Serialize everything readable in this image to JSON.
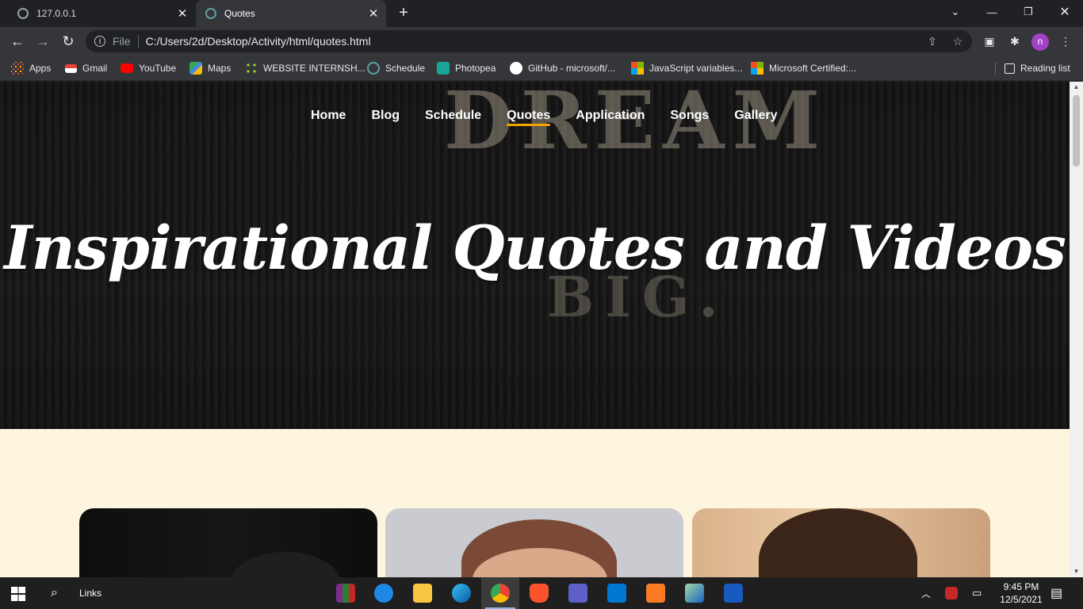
{
  "browser": {
    "tabs": [
      {
        "title": "127.0.0.1",
        "active": false
      },
      {
        "title": "Quotes",
        "active": true
      }
    ],
    "address": {
      "scheme_label": "File",
      "url": "C:/Users/2d/Desktop/Activity/html/quotes.html"
    },
    "profile_initial": "n",
    "bookmarks": [
      {
        "label": "Apps",
        "icon": "apps-grid-icon",
        "color": "#ea4335"
      },
      {
        "label": "Gmail",
        "icon": "gmail-icon",
        "color": "#ea4335"
      },
      {
        "label": "YouTube",
        "icon": "youtube-icon",
        "color": "#ff0000"
      },
      {
        "label": "Maps",
        "icon": "maps-icon",
        "color": "#34a853"
      },
      {
        "label": "WEBSITE INTERNSH...",
        "icon": "bookmark-icon",
        "color": "#34a853"
      },
      {
        "label": "Schedule",
        "icon": "globe-icon",
        "color": "#5f9ea0"
      },
      {
        "label": "Photopea",
        "icon": "photopea-icon",
        "color": "#18a497"
      },
      {
        "label": "GitHub - microsoft/...",
        "icon": "github-icon",
        "color": "#ffffff"
      },
      {
        "label": "JavaScript variables...",
        "icon": "microsoft-icon",
        "color": "#f25022"
      },
      {
        "label": "Microsoft Certified:...",
        "icon": "microsoft-icon",
        "color": "#f25022"
      }
    ],
    "reading_list": "Reading list"
  },
  "page": {
    "nav": [
      {
        "label": "Home",
        "current": false
      },
      {
        "label": "Blog",
        "current": false
      },
      {
        "label": "Schedule",
        "current": false
      },
      {
        "label": "Quotes",
        "current": true
      },
      {
        "label": "Application",
        "current": false
      },
      {
        "label": "Songs",
        "current": false
      },
      {
        "label": "Gallery",
        "current": false
      }
    ],
    "hero_title": "Inspirational Quotes and Videos",
    "accent_color": "#f0a500",
    "section_background": "#fdf5de"
  },
  "taskbar": {
    "search_label": "Links",
    "time": "9:45 PM",
    "date": "12/5/2021"
  }
}
